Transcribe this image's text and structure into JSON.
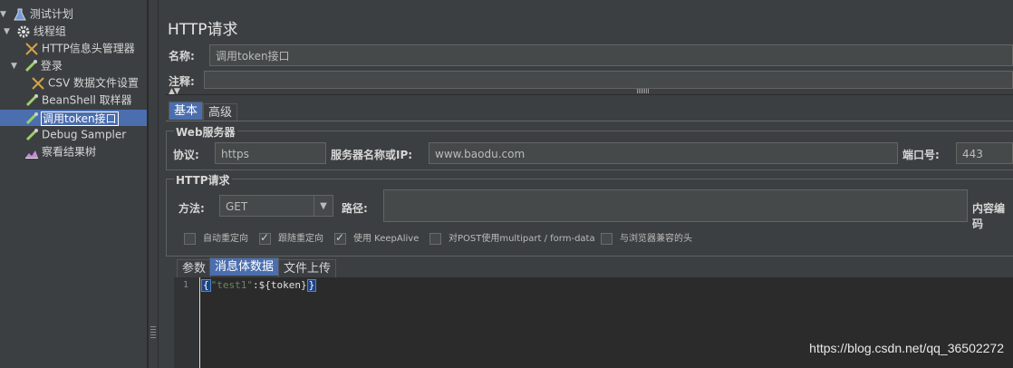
{
  "tree": {
    "items": [
      {
        "label": "测试计划",
        "icon": "flask-icon"
      },
      {
        "label": "线程组",
        "icon": "gear-icon"
      },
      {
        "label": "HTTP信息头管理器",
        "icon": "tools-icon"
      },
      {
        "label": "登录",
        "icon": "pipette-icon"
      },
      {
        "label": "CSV 数据文件设置",
        "icon": "tools-icon"
      },
      {
        "label": "BeanShell 取样器",
        "icon": "pipette-icon"
      },
      {
        "label": "调用token接口",
        "icon": "pipette-icon"
      },
      {
        "label": "Debug Sampler",
        "icon": "pipette-icon"
      },
      {
        "label": "察看结果树",
        "icon": "chart-icon"
      }
    ]
  },
  "main": {
    "title": "HTTP请求",
    "name_label": "名称:",
    "name_value": "调用token接口",
    "comment_label": "注释:",
    "comment_value": "",
    "tabs": [
      {
        "label": "基本"
      },
      {
        "label": "高级"
      }
    ],
    "web_server": {
      "group_label": "Web服务器",
      "protocol_label": "协议:",
      "protocol_value": "https",
      "server_label": "服务器名称或IP:",
      "server_value": "www.baodu.com",
      "port_label": "端口号:",
      "port_value": "443"
    },
    "http_request": {
      "group_label": "HTTP请求",
      "method_label": "方法:",
      "method_value": "GET",
      "path_label": "路径:",
      "path_value": "",
      "encoding_label": "内容编码",
      "checkboxes": [
        {
          "label": "自动重定向",
          "checked": false
        },
        {
          "label": "跟随重定向",
          "checked": true
        },
        {
          "label": "使用 KeepAlive",
          "checked": true
        },
        {
          "label": "对POST使用multipart / form-data",
          "checked": false
        },
        {
          "label": "与浏览器兼容的头",
          "checked": false
        }
      ]
    },
    "body_tabs": [
      {
        "label": "参数"
      },
      {
        "label": "消息体数据"
      },
      {
        "label": "文件上传"
      }
    ],
    "editor": {
      "line_number": "1",
      "open_brace": "{",
      "key": "\"test1\"",
      "rest": ":${token}",
      "close_brace": "}"
    }
  },
  "watermark": "https://blog.csdn.net/qq_36502272"
}
